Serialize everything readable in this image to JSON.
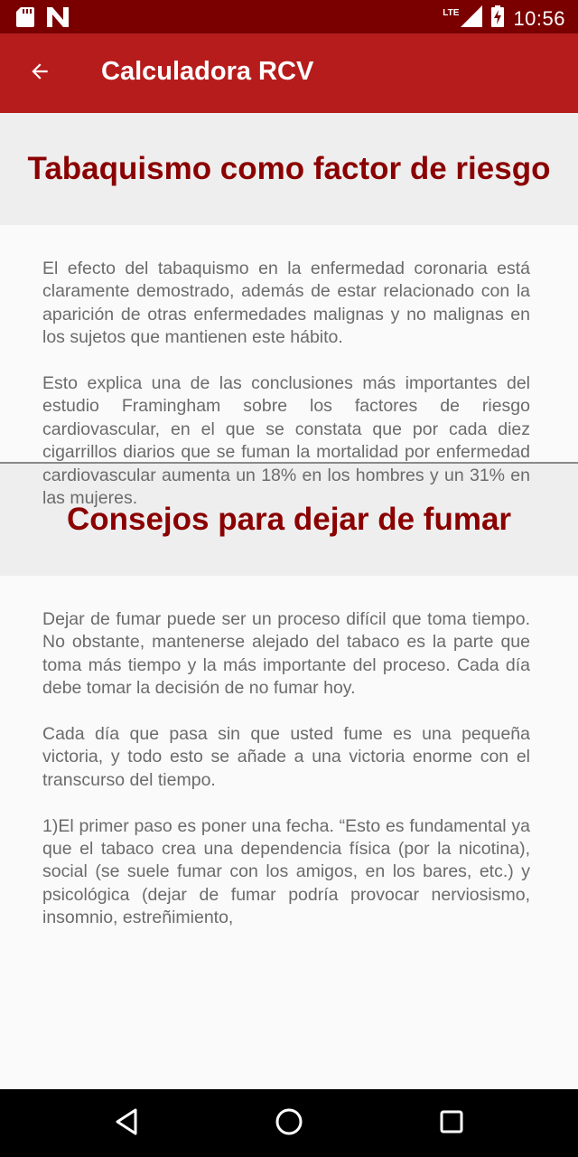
{
  "status_bar": {
    "time": "10:56",
    "network": "LTE",
    "icons": [
      "sd-card-icon",
      "notification-n-icon",
      "signal-icon",
      "battery-charging-icon"
    ]
  },
  "app_bar": {
    "title": "Calculadora RCV",
    "back_icon": "arrow-back-icon"
  },
  "sections": [
    {
      "title": "Tabaquismo como factor de riesgo",
      "paragraphs": [
        "El efecto del tabaquismo en la enfermedad coronaria está claramente demostrado, además de estar relacionado con la aparición de otras enfermedades malignas y no malignas en los sujetos que mantienen este hábito.",
        "Esto explica una de las conclusiones más importantes del estudio Framingham sobre los factores de riesgo cardiovascular, en el que se constata que por cada diez cigarrillos diarios que se fuman la mortalidad por enfermedad cardiovascular aumenta un 18% en los hombres y un 31% en las mujeres."
      ]
    },
    {
      "title": "Consejos para dejar de fumar",
      "paragraphs": [
        "Dejar de fumar puede ser un proceso difícil que toma tiempo. No obstante, mantenerse alejado del tabaco es la parte que toma más tiempo y la más importante del proceso. Cada día debe tomar la decisión de no fumar hoy.",
        "Cada día que pasa sin que usted fume es una pequeña victoria, y todo esto se añade a una victoria enorme con el transcurso del tiempo.",
        "1)El primer paso es poner una fecha. “Esto es fundamental ya que el tabaco crea una dependencia física (por la nicotina), social (se suele fumar con los amigos, en los bares, etc.) y psicológica (dejar de fumar podría provocar nerviosismo, insomnio, estreñimiento,"
      ]
    }
  ],
  "nav_bar": {
    "icons": [
      "back-triangle-icon",
      "home-circle-icon",
      "recents-square-icon"
    ]
  },
  "colors": {
    "status_bar": "#7a0000",
    "app_bar": "#b71c1c",
    "section_title": "#8b0000",
    "body_text": "#6b6b6b"
  }
}
